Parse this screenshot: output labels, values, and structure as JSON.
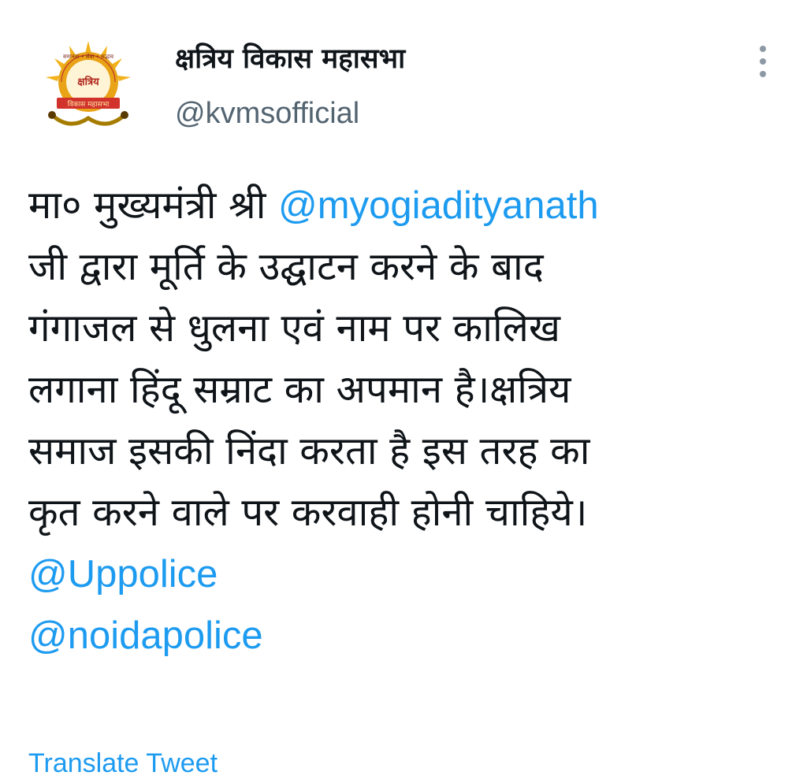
{
  "tweet": {
    "author": {
      "display_name": "क्षत्रिय विकास महासभा",
      "handle": "@kvmsofficial",
      "avatar": {
        "logo_text": "क्षत्रिय",
        "ribbon_text": "विकास महासभा",
        "arc_text": "समानता • सेवा • सद्भाव",
        "accent_color": "#e8a317",
        "ribbon_color": "#d1322b"
      }
    },
    "menu_icon": "more-vertical-icon",
    "body": {
      "line1_text": "मा० मुख्यमंत्री श्री ",
      "line1_mention": "@myogiadityanath",
      "line2": "जी द्वारा मूर्ति के उद्घाटन करने के बाद",
      "line3": "गंगाजल से धुलना एवं नाम पर कालिख",
      "line4": "लगाना हिंदू सम्राट का अपमान है।क्षत्रिय",
      "line5": "समाज इसकी निंदा करता है इस तरह का",
      "line6": "कृत करने वाले पर करवाही होनी चाहिये।",
      "mention2": "@Uppolice",
      "mention3": "@noidapolice"
    },
    "translate_label": "Translate Tweet",
    "colors": {
      "link": "#1d9bf0",
      "text": "#0f1419",
      "secondary": "#536471"
    }
  }
}
